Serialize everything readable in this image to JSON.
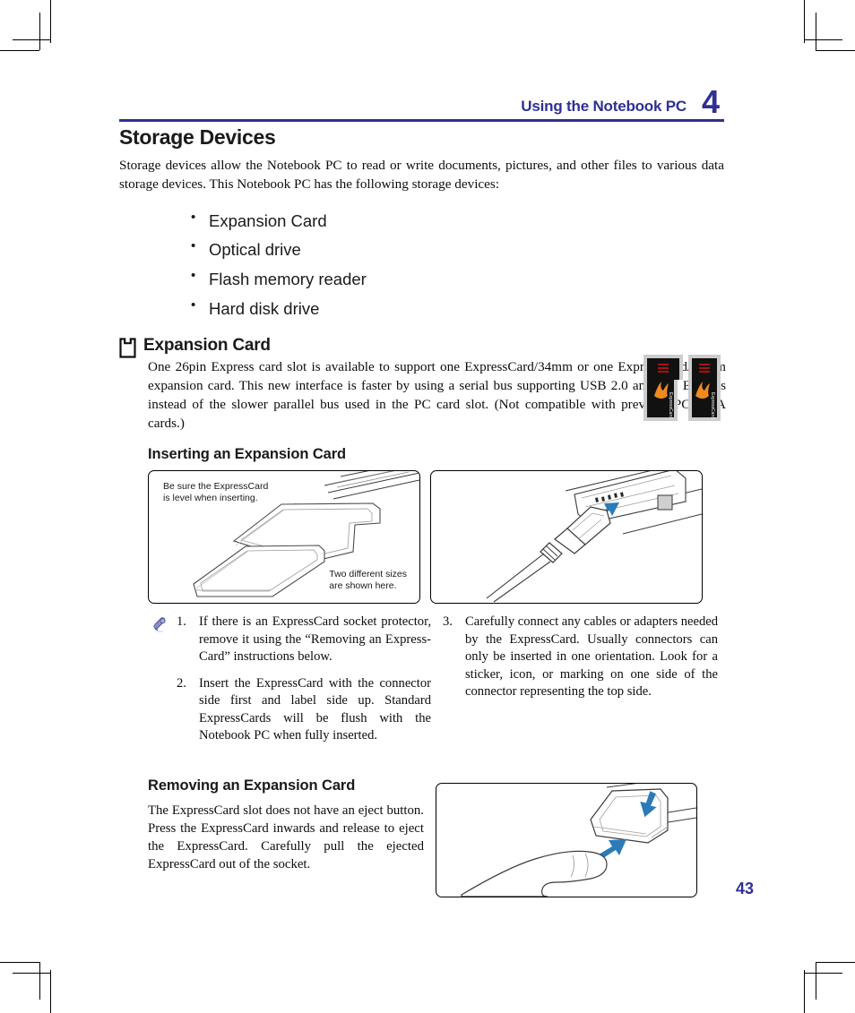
{
  "header": {
    "title": "Using the Notebook PC",
    "chapter": "4"
  },
  "section": {
    "title": "Storage Devices",
    "intro": "Storage devices allow the Notebook PC to read or write documents, pictures, and other files to various data storage devices. This Notebook PC has the following storage devices:",
    "devices": [
      "Expansion Card",
      "Optical drive",
      "Flash memory reader",
      "Hard disk drive"
    ]
  },
  "expansion_card": {
    "icon": "expansion-card-icon",
    "heading": "Expansion Card",
    "body": "One 26pin Express card slot is available to support one ExpressCard/34mm or one ExpressCard/54mm expansion card. This new interface is faster by using a serial bus supporting USB 2.0 and PCI Express instead of the slower parallel bus used in the PC card slot. (Not compatible with previous PCMCIA cards.)",
    "cards_image_label": "ExpressCard"
  },
  "inserting": {
    "heading": "Inserting an Expansion Card",
    "figure1": {
      "caption_top": "Be sure the ExpressCard\nis level when inserting.",
      "caption_bottom": "Two different sizes\nare shown here."
    },
    "figure2": {
      "alt": "Cable connector being plugged into an ExpressCard"
    },
    "note_icon": "pen-note-icon",
    "steps_left": [
      {
        "num": "1.",
        "text": "If there is an ExpressCard socket protector, remove it using the “Removing an Express-Card” instructions below."
      },
      {
        "num": "2.",
        "text": "Insert the ExpressCard with the connector side first and label side up. Standard  ExpressCards will be flush with the Notebook PC when fully inserted."
      }
    ],
    "steps_right": [
      {
        "num": "3.",
        "text": "Carefully connect any cables or adapters needed by the ExpressCard. Usually connectors can only be inserted in one orientation. Look for a sticker, icon, or marking on one side of the connector representing the top side."
      }
    ]
  },
  "removing": {
    "heading": "Removing an Expansion Card",
    "body": "The ExpressCard slot does not have an eject button. Press the ExpressCard inwards and release to eject the ExpressCard. Carefully pull the ejected ExpressCard out of the socket.",
    "figure3": {
      "alt": "Finger pressing ExpressCard inward to eject it"
    }
  },
  "page_number": "43",
  "colors": {
    "brand_blue": "#2e3192",
    "arrow_blue": "#2b7bba",
    "text_black": "#0d0d0d",
    "flame_orange": "#f08a1e"
  }
}
